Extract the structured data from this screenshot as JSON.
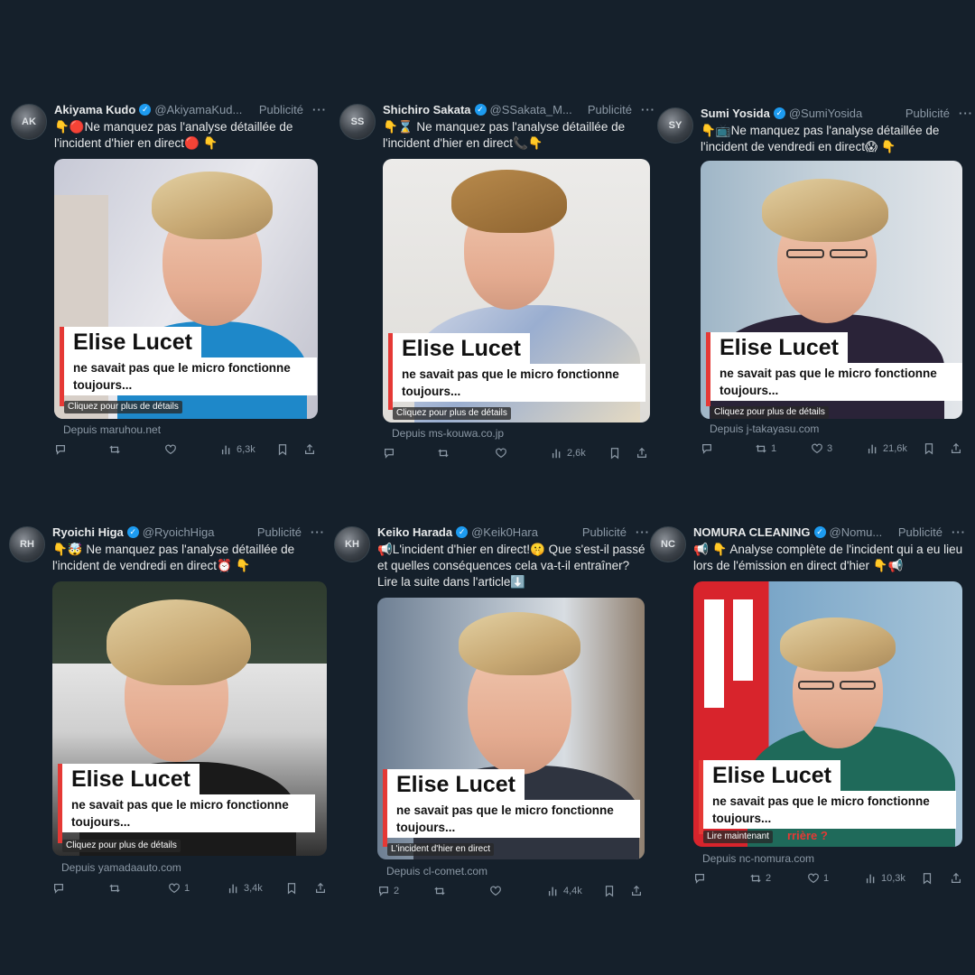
{
  "common": {
    "ad_label": "Publicité",
    "headline": "Elise Lucet",
    "subline": "ne savait pas que le micro fonctionne toujours..."
  },
  "tweets": [
    {
      "name": "Akiyama Kudo",
      "handle": "@AkiyamaKud...",
      "text": "👇🔴Ne manquez pas l'analyse détaillée de l'incident d'hier en direct🔴 👇",
      "cta": "Cliquez pour plus de détails",
      "source": "Depuis maruhou.net",
      "replies": "",
      "retweets": "",
      "likes": "",
      "views": "6,3k"
    },
    {
      "name": "Shichiro Sakata",
      "handle": "@SSakata_M...",
      "text": "👇⌛ Ne manquez pas l'analyse détaillée de l'incident d'hier en direct📞👇",
      "cta": "Cliquez pour plus de détails",
      "source": "Depuis ms-kouwa.co.jp",
      "replies": "",
      "retweets": "",
      "likes": "",
      "views": "2,6k"
    },
    {
      "name": "Sumi Yosida",
      "handle": "@SumiYosida",
      "text": "👇📺Ne manquez pas l'analyse détaillée de l'incident de vendredi en direct😱 👇",
      "cta": "Cliquez pour plus de détails",
      "source": "Depuis j-takayasu.com",
      "replies": "",
      "retweets": "1",
      "likes": "3",
      "views": "21,6k"
    },
    {
      "name": "Ryoichi Higa",
      "handle": "@RyoichHiga",
      "text": "👇🤯 Ne manquez pas l'analyse détaillée de l'incident de vendredi en direct⏰ 👇",
      "cta": "Cliquez pour plus de détails",
      "source": "Depuis yamadaauto.com",
      "replies": "",
      "retweets": "",
      "likes": "1",
      "views": "3,4k"
    },
    {
      "name": "Keiko Harada",
      "handle": "@Keik0Hara",
      "text": "📢L'incident d'hier en direct!🤫 Que s'est-il passé et quelles conséquences cela va-t-il entraîner? Lire la suite dans l'article⬇️",
      "cta": "L'incident d'hier en direct",
      "source": "Depuis cl-comet.com",
      "replies": "2",
      "retweets": "",
      "likes": "",
      "views": "4,4k"
    },
    {
      "name": "NOMURA CLEANING",
      "handle": "@Nomu...",
      "text": "📢 👇 Analyse complète de l'incident qui a eu lieu lors de l'émission en direct d'hier 👇📢",
      "cta": "Lire maintenant",
      "cta_extra": "rrière ?",
      "source": "Depuis nc-nomura.com",
      "replies": "",
      "retweets": "2",
      "likes": "1",
      "views": "10,3k"
    }
  ],
  "icons": [
    "reply-icon",
    "retweet-icon",
    "like-icon",
    "views-icon",
    "bookmark-icon",
    "share-icon",
    "verified-badge-icon",
    "more-icon"
  ],
  "colors": {
    "background": "#15202b",
    "accent": "#1d9bf0",
    "overlay_bar": "#e53935",
    "muted": "#8b98a5"
  }
}
